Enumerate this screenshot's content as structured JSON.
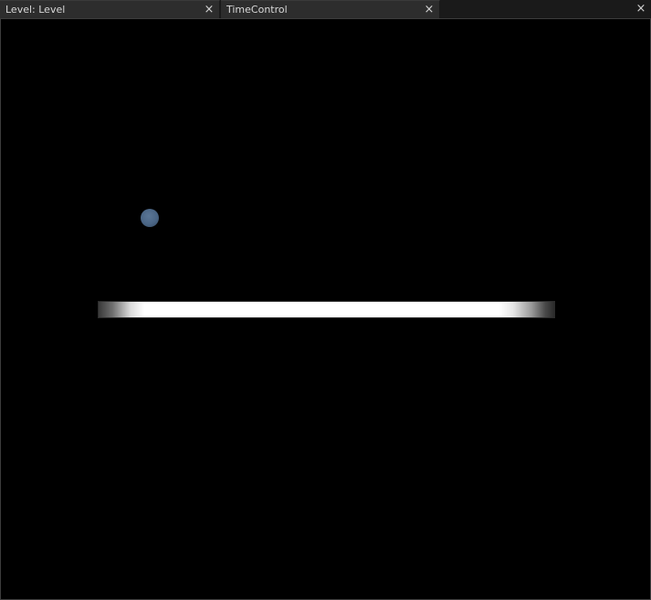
{
  "tabs": [
    {
      "label": "Level: Level",
      "close_glyph": "×"
    },
    {
      "label": "TimeControl",
      "close_glyph": "×"
    }
  ],
  "empty_tab": {
    "close_glyph": "×"
  },
  "scene": {
    "ball_color": "#4a6585",
    "paddle_color": "#ffffff",
    "background_color": "#000000"
  }
}
